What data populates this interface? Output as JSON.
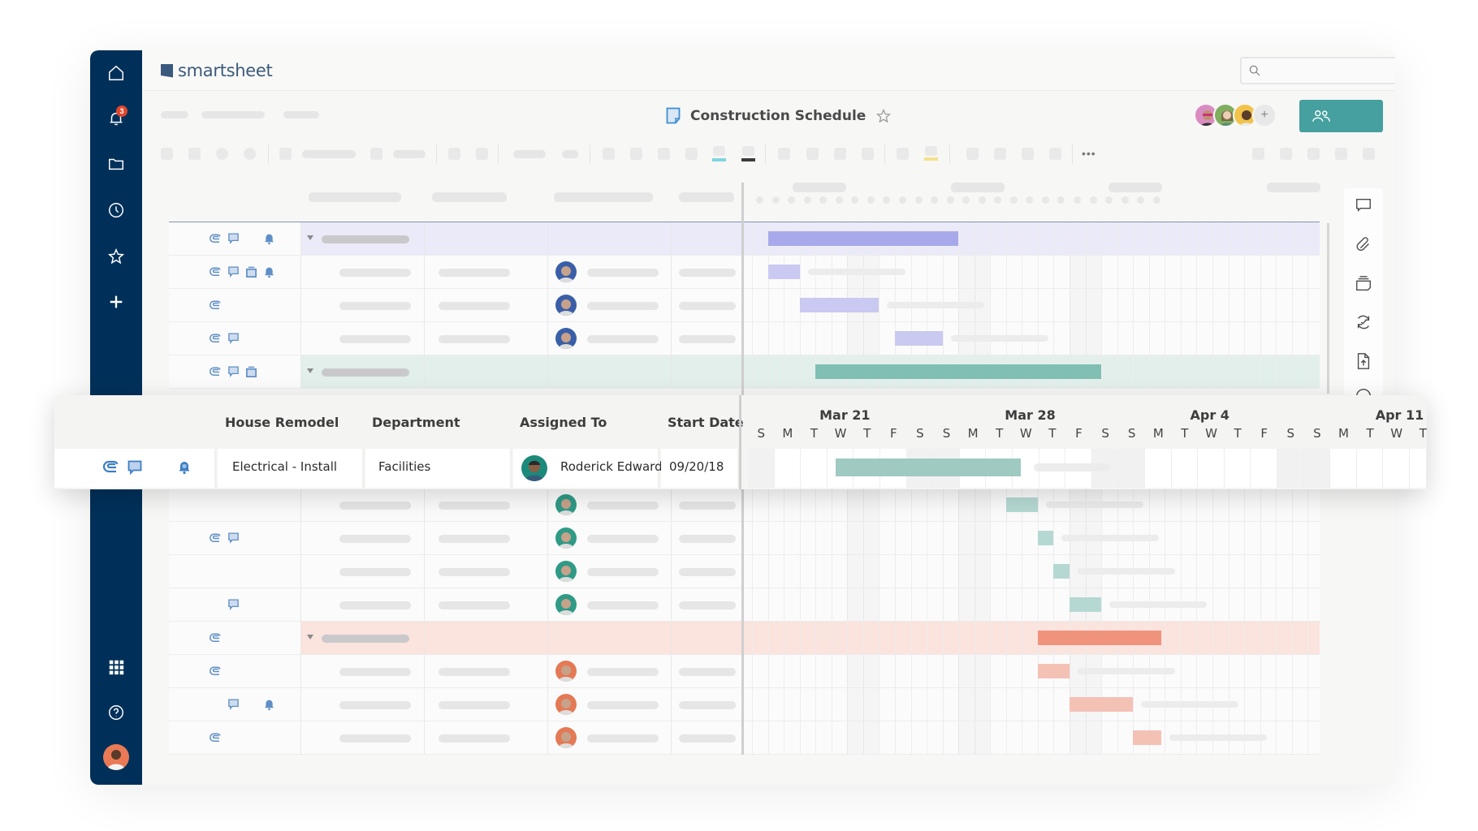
{
  "app": {
    "brand": "smartsheet",
    "sheet_title": "Construction Schedule",
    "notification_count": "3",
    "search": {
      "placeholder": "",
      "value": ""
    },
    "share_button_label": "",
    "collaborators_more": "+"
  },
  "sidebar": {
    "items": [
      {
        "name": "home",
        "icon": "home-icon"
      },
      {
        "name": "notifications",
        "icon": "bell-icon",
        "badge": "3"
      },
      {
        "name": "browse",
        "icon": "folder-icon"
      },
      {
        "name": "recents",
        "icon": "clock-icon"
      },
      {
        "name": "favorites",
        "icon": "star-icon"
      },
      {
        "name": "create",
        "icon": "plus-icon"
      }
    ],
    "bottom_items": [
      {
        "name": "apps",
        "icon": "grid-icon"
      },
      {
        "name": "help",
        "icon": "help-icon"
      },
      {
        "name": "profile",
        "icon": "avatar"
      }
    ]
  },
  "right_panel": {
    "items": [
      "comment-icon",
      "attachment-icon",
      "proofing-icon",
      "update-request-icon",
      "publish-icon"
    ]
  },
  "colors": {
    "sidebar": "#003059",
    "accent_teal": "#45a09f",
    "purple_bar": "#a7a9ea",
    "purple_light": "#c9c9f1",
    "teal_bar": "#7fc0b3",
    "teal_light": "#b5d9d2",
    "salmon_bar": "#f0937c",
    "salmon_light": "#f4c1b5",
    "icon_blue": "#3d7fc4"
  },
  "expanded_row": {
    "headers": {
      "primary": "House Remodel",
      "department": "Department",
      "assigned_to": "Assigned To",
      "start_date": "Start Date"
    },
    "row": {
      "task": "Electrical - Install",
      "department": "Facilities",
      "assigned_to": "Roderick Edwards",
      "start_date": "09/20/18",
      "has_attachment": true,
      "has_comment": true,
      "has_reminder": true
    },
    "timeline": {
      "months": [
        {
          "label": "Mar 21"
        },
        {
          "label": "Mar 28"
        },
        {
          "label": "Apr 4"
        },
        {
          "label": "Apr 11"
        }
      ],
      "days": [
        "S",
        "M",
        "T",
        "W",
        "T",
        "F",
        "S",
        "S",
        "M",
        "T",
        "W",
        "T",
        "F",
        "S",
        "S",
        "M",
        "T",
        "W",
        "T",
        "F",
        "S",
        "S",
        "M",
        "T",
        "W",
        "T"
      ],
      "bar": {
        "start_day": 3.3,
        "end_day": 10.3,
        "color": "#9fcac1"
      }
    }
  },
  "background_rows": [
    {
      "type": "parent",
      "color": "purple",
      "icons": [
        "attachment",
        "comment",
        "reminder"
      ],
      "bar": [
        1,
        13
      ]
    },
    {
      "type": "child",
      "icons": [
        "attachment",
        "comment",
        "proofing",
        "reminder"
      ],
      "avatar": "blue",
      "bar": [
        1,
        3
      ]
    },
    {
      "type": "child",
      "icons": [
        "attachment"
      ],
      "avatar": "blue",
      "bar": [
        3,
        8
      ]
    },
    {
      "type": "child",
      "icons": [
        "attachment",
        "comment"
      ],
      "avatar": "blue",
      "bar": [
        9,
        12
      ]
    },
    {
      "type": "parent",
      "color": "teal",
      "icons": [
        "attachment",
        "comment",
        "proofing"
      ],
      "bar": [
        4,
        22
      ]
    },
    {
      "type": "child",
      "icons": [],
      "avatar": "green",
      "bar": [
        16,
        18
      ]
    },
    {
      "type": "child",
      "icons": [
        "attachment",
        "comment"
      ],
      "avatar": "green",
      "bar": [
        18,
        19
      ]
    },
    {
      "type": "child",
      "icons": [],
      "avatar": "green",
      "bar": [
        19,
        20
      ]
    },
    {
      "type": "child",
      "icons": [
        "comment"
      ],
      "avatar": "green",
      "bar": [
        20,
        22
      ]
    },
    {
      "type": "parent",
      "color": "salmon",
      "icons": [
        "attachment"
      ],
      "bar": [
        18,
        25.8
      ]
    },
    {
      "type": "child",
      "icons": [
        "attachment"
      ],
      "avatar": "orange",
      "bar": [
        18,
        20
      ]
    },
    {
      "type": "child",
      "icons": [
        "comment",
        "reminder"
      ],
      "avatar": "orange",
      "bar": [
        20,
        24
      ]
    },
    {
      "type": "child",
      "icons": [
        "attachment"
      ],
      "avatar": "orange",
      "bar": [
        24,
        25.8
      ]
    }
  ]
}
